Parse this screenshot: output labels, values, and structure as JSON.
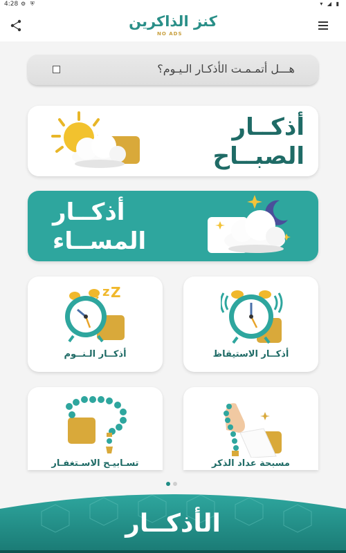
{
  "status_bar": {
    "time": "4:28",
    "left_icons": "⚙ ⛨",
    "right_icons": "▾ ◢ ▮"
  },
  "app": {
    "logo_main": "كنز الذاكرين",
    "logo_sub": "NO ADS"
  },
  "question": {
    "text": "هـــل أتمـمـت الأذكـار الـيـوم؟",
    "checked": false
  },
  "cards": {
    "morning": {
      "line1": "أذكــار",
      "line2": "الصبــاح"
    },
    "evening": {
      "line1": "أذكــار",
      "line2": "المســاء"
    },
    "waking": {
      "label": "أذكــار الاستيقاظ"
    },
    "sleep": {
      "label": "أذكــار الـنــوم"
    },
    "tasbih_counter": {
      "label": "مسبحة عداد الذكر"
    },
    "istighfar": {
      "label": "تسـابيـح الاسـتغفـار"
    }
  },
  "pager": {
    "current": 1,
    "total": 2
  },
  "footer": {
    "title": "الأذكــار"
  },
  "colors": {
    "teal": "#2ea69e",
    "dark_teal": "#1f6b66",
    "gold": "#d9a93a"
  }
}
